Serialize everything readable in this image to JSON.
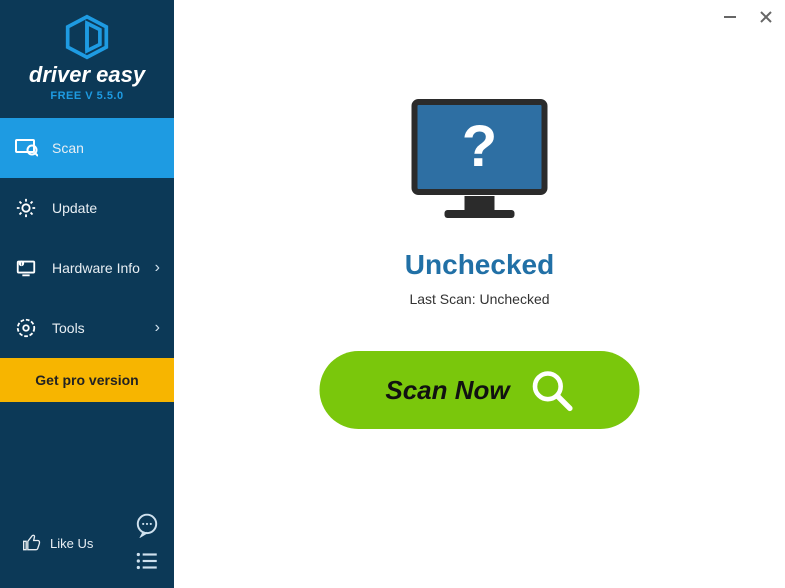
{
  "brand": {
    "name": "driver easy",
    "version_label": "FREE V 5.5.0",
    "accent_color": "#1e9be2",
    "sidebar_color": "#0c3957",
    "pro_bar_color": "#f7b500",
    "scan_btn_color": "#7ac70c"
  },
  "sidebar": {
    "items": [
      {
        "label": "Scan",
        "icon": "scan-icon",
        "has_submenu": false,
        "active": true
      },
      {
        "label": "Update",
        "icon": "gear-icon",
        "has_submenu": false,
        "active": false
      },
      {
        "label": "Hardware Info",
        "icon": "hardware-icon",
        "has_submenu": true,
        "active": false
      },
      {
        "label": "Tools",
        "icon": "tools-icon",
        "has_submenu": true,
        "active": false
      }
    ],
    "pro_label": "Get pro version",
    "like_label": "Like Us"
  },
  "main": {
    "status_title": "Unchecked",
    "last_scan_label": "Last Scan: Unchecked",
    "scan_button_label": "Scan Now"
  },
  "window": {
    "minimize": "−",
    "close": "×"
  }
}
